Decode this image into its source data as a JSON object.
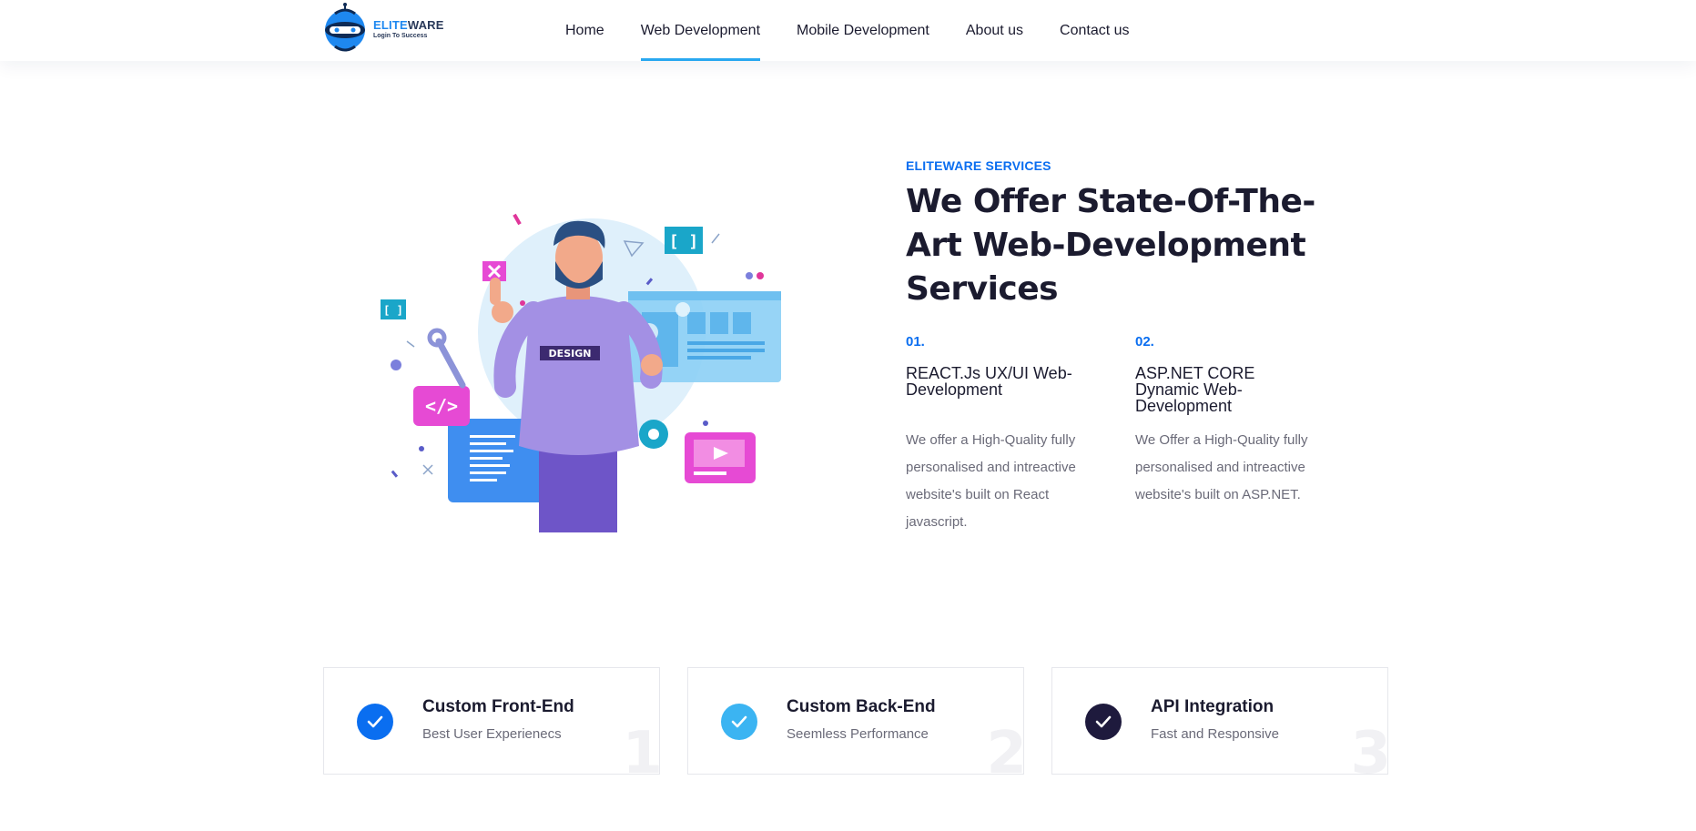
{
  "brand": {
    "name_part1": "ELITE",
    "name_part2": "WARE",
    "tagline": "Login To Success"
  },
  "nav": {
    "items": [
      {
        "label": "Home",
        "active": false
      },
      {
        "label": "Web Development",
        "active": true
      },
      {
        "label": "Mobile Development",
        "active": false
      },
      {
        "label": "About us",
        "active": false
      },
      {
        "label": "Contact us",
        "active": false
      }
    ]
  },
  "hero": {
    "eyebrow": "ELITEWARE SERVICES",
    "title": "We Offer State-Of-The-Art Web-Development Services",
    "illustration": {
      "shirt_text": "DESIGN",
      "code_badge": "</>",
      "bracket_badge": "[ ]"
    }
  },
  "services": [
    {
      "number": "01.",
      "title": "REACT.Js UX/UI Web-Development",
      "description": "We offer a High-Quality fully personalised and intreactive website's built on React javascript."
    },
    {
      "number": "02.",
      "title": "ASP.NET CORE Dynamic Web-Development",
      "description": "We Offer a High-Quality fully personalised and intreactive website's built on ASP.NET."
    }
  ],
  "features": [
    {
      "title": "Custom Front-End",
      "subtitle": "Best User Experienecs",
      "number": "1",
      "icon": "check-icon",
      "color": "#0a6ef0"
    },
    {
      "title": "Custom Back-End",
      "subtitle": "Seemless Performance",
      "number": "2",
      "icon": "check-icon",
      "color": "#3bb4f2"
    },
    {
      "title": "API Integration",
      "subtitle": "Fast and Responsive",
      "number": "3",
      "icon": "check-icon",
      "color": "#1e1a3d"
    }
  ],
  "colors": {
    "accent": "#0a6ef0",
    "nav_underline": "#29a8f0",
    "heading": "#1b1b2f",
    "body_text": "#6a6a78"
  }
}
